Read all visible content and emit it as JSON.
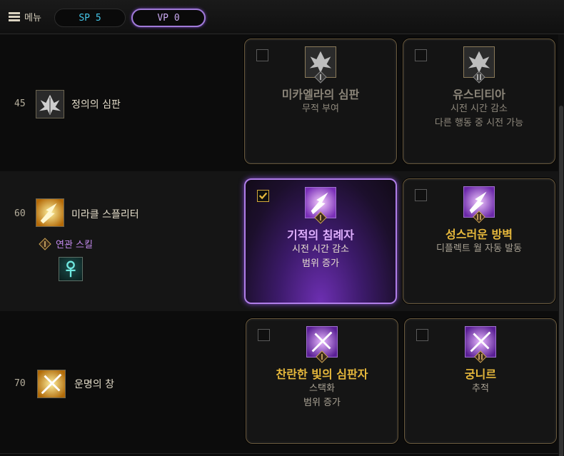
{
  "topbar": {
    "menu_label": "메뉴",
    "sp_label": "SP 5",
    "vp_label": "VP 0"
  },
  "rows": [
    {
      "level": "45",
      "skill_name": "정의의 심판",
      "cards": [
        {
          "title": "미카엘라의 심판",
          "desc": [
            "무적 부여"
          ],
          "checked": false,
          "rank": "I"
        },
        {
          "title": "유스티티아",
          "desc": [
            "시전 시간 감소",
            "다른 행동 중 시전 가능"
          ],
          "checked": false,
          "rank": "II"
        }
      ]
    },
    {
      "level": "60",
      "skill_name": "미라클 스플리터",
      "related_label": "연관 스킬",
      "related_icon": "ankh-icon",
      "cards": [
        {
          "title": "기적의 침례자",
          "desc": [
            "시전 시간 감소",
            "범위 증가"
          ],
          "checked": true,
          "rank": "I"
        },
        {
          "title": "성스러운 방벽",
          "desc": [
            "디플렉트 월 자동 발동"
          ],
          "checked": false,
          "rank": "II"
        }
      ]
    },
    {
      "level": "70",
      "skill_name": "운명의 창",
      "cards": [
        {
          "title": "찬란한 빛의 심판자",
          "desc": [
            "스택화",
            "범위 증가"
          ],
          "checked": false,
          "rank": "I"
        },
        {
          "title": "궁니르",
          "desc": [
            "추적"
          ],
          "checked": false,
          "rank": "II"
        }
      ]
    }
  ],
  "colors": {
    "gold": "#e7b93c",
    "purple_accent": "#b07ee8",
    "sp_cyan": "#45c6e8"
  }
}
